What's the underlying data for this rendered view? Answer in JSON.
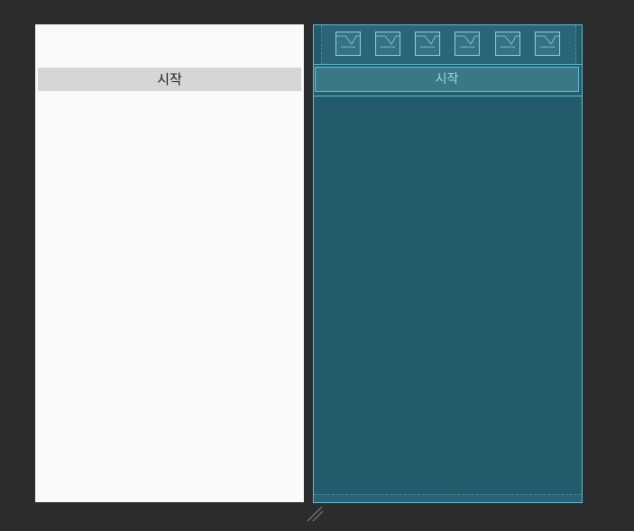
{
  "design_preview": {
    "start_button_label": "시작"
  },
  "blueprint_preview": {
    "image_views": [
      {
        "label": "ImageView"
      },
      {
        "label": "ImageView"
      },
      {
        "label": "ImageView"
      },
      {
        "label": "ImageView"
      },
      {
        "label": "ImageView"
      },
      {
        "label": "ImageView"
      }
    ],
    "start_button_label": "시작"
  },
  "icons": {
    "image_placeholder": "image-view-icon",
    "resize": "resize-handle-icon"
  },
  "colors": {
    "editor_background": "#2b2c2e",
    "design_surface": "#fafafa",
    "design_button": "#d6d6d6",
    "blueprint_surface": "#235b6d",
    "blueprint_outline": "#5fb9cf",
    "blueprint_text": "#9fd8e6"
  }
}
